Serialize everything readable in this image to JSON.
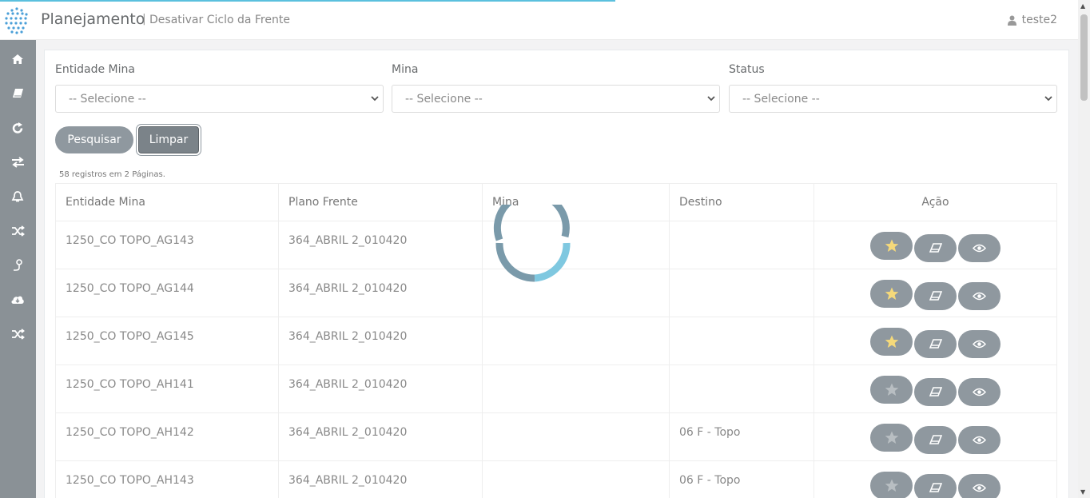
{
  "header": {
    "app_title": "Planejamento",
    "separator": "|",
    "page_subtitle": "Desativar Ciclo da Frente",
    "user": "teste2"
  },
  "sidebar": {
    "items": [
      {
        "icon": "home-icon"
      },
      {
        "icon": "book-icon"
      },
      {
        "icon": "refresh-icon"
      },
      {
        "icon": "exchange-icon"
      },
      {
        "icon": "bell-icon"
      },
      {
        "icon": "random-icon"
      },
      {
        "icon": "route-icon"
      },
      {
        "icon": "cloud-download-icon"
      },
      {
        "icon": "random-icon"
      }
    ]
  },
  "filters": {
    "entidade_label": "Entidade Mina",
    "entidade_value": "-- Selecione --",
    "mina_label": "Mina",
    "mina_value": "-- Selecione --",
    "status_label": "Status",
    "status_value": "-- Selecione --"
  },
  "buttons": {
    "search": "Pesquisar",
    "clear": "Limpar"
  },
  "records_info": "58 registros em 2 Páginas.",
  "table": {
    "headers": [
      "Entidade Mina",
      "Plano Frente",
      "Mina",
      "Destino",
      "Ação"
    ],
    "rows": [
      {
        "entidade": "1250_CO TOPO_AG143",
        "plano": "364_ABRIL 2_010420",
        "mina": "",
        "destino": "",
        "favorite": true
      },
      {
        "entidade": "1250_CO TOPO_AG144",
        "plano": "364_ABRIL 2_010420",
        "mina": "",
        "destino": "",
        "favorite": true
      },
      {
        "entidade": "1250_CO TOPO_AG145",
        "plano": "364_ABRIL 2_010420",
        "mina": "",
        "destino": "",
        "favorite": true
      },
      {
        "entidade": "1250_CO TOPO_AH141",
        "plano": "364_ABRIL 2_010420",
        "mina": "",
        "destino": "",
        "favorite": false
      },
      {
        "entidade": "1250_CO TOPO_AH142",
        "plano": "364_ABRIL 2_010420",
        "mina": "",
        "destino": "06 F - Topo",
        "favorite": false
      },
      {
        "entidade": "1250_CO TOPO_AH143",
        "plano": "364_ABRIL 2_010420",
        "mina": "",
        "destino": "06 F - Topo",
        "favorite": false
      }
    ]
  },
  "colors": {
    "sidebar": "#8a9196",
    "button": "#8f989f",
    "star_active": "#f5d97a",
    "star_inactive": "#b8bec2",
    "spinner_dark": "#7a9aaa",
    "spinner_light": "#7fc8e0",
    "progress": "#5bc0de"
  }
}
